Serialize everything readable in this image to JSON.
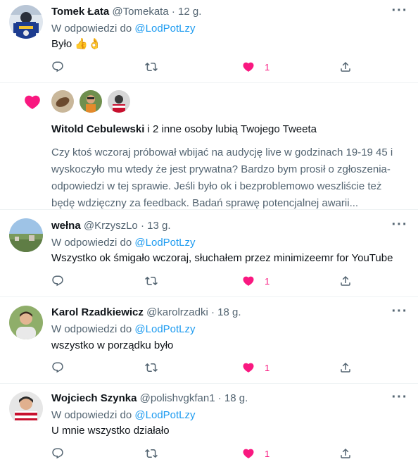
{
  "tweets": [
    {
      "name": "Tomek Łata",
      "handle": "@Tomekata",
      "separator": "·",
      "time": "12 g.",
      "reply_prefix": "W odpowiedzi do",
      "reply_mention": "@LodPotLzy",
      "text": "Było 👍👌",
      "likes": "1",
      "avatar_icon": "hockey-player-avatar"
    },
    {
      "name": "wełna",
      "handle": "@KrzyszLo",
      "separator": "·",
      "time": "13 g.",
      "reply_prefix": "W odpowiedzi do",
      "reply_mention": "@LodPotLzy",
      "text": "Wszystko ok śmigało wczoraj, słuchałem przez minimizeemr for YouTube",
      "likes": "1",
      "avatar_icon": "landscape-avatar"
    },
    {
      "name": "Karol Rzadkiewicz",
      "handle": "@karolrzadki",
      "separator": "·",
      "time": "18 g.",
      "reply_prefix": "W odpowiedzi do",
      "reply_mention": "@LodPotLzy",
      "text": "wszystko w porządku było",
      "likes": "1",
      "avatar_icon": "person-avatar"
    },
    {
      "name": "Wojciech Szynka",
      "handle": "@polishvgkfan1",
      "separator": "·",
      "time": "18 g.",
      "reply_prefix": "W odpowiedzi do",
      "reply_mention": "@LodPotLzy",
      "text": "U mnie wszystko działało",
      "likes": "1",
      "avatar_icon": "hockey-goalie-avatar"
    }
  ],
  "notification": {
    "liker_name": "Witold Cebulewski",
    "rest": " i 2 inne osoby lubią Twojego Tweeta",
    "tweet_lines": [
      "Czy ktoś wczoraj próbował wbijać na audycję live w godzinach 19-19 45 i",
      "wyskoczyło mu wtedy że jest prywatna? Bardzo bym prosił o zgłoszenia-",
      "odpowiedzi w tej sprawie. Jeśli było ok i bezproblemowo weszliście też",
      "będę wdzięczny za feedback. Badań sprawę potencjalnej awarii..."
    ]
  },
  "colors": {
    "like": "#f91880",
    "link": "#1d9bf0",
    "secondary_text": "#536471",
    "divider": "#eff3f4"
  }
}
